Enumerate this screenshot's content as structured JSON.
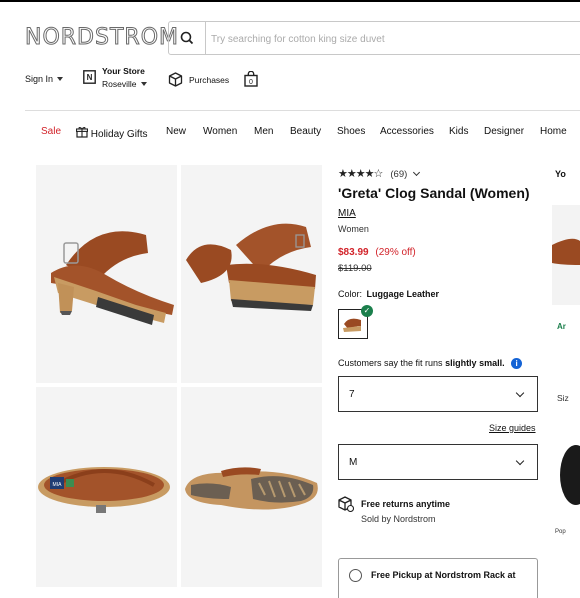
{
  "header": {
    "logo": "NORDSTROM",
    "search_placeholder": "Try searching for cotton king size duvet",
    "sign_in": "Sign In",
    "your_store": "Your Store",
    "store_name": "Roseville",
    "purchases": "Purchases"
  },
  "nav": [
    "Sale",
    "Holiday Gifts",
    "New",
    "Women",
    "Men",
    "Beauty",
    "Shoes",
    "Accessories",
    "Kids",
    "Designer",
    "Home"
  ],
  "product": {
    "rating_stars": "★★★★☆",
    "rating_count": "(69)",
    "title": "'Greta' Clog Sandal (Women)",
    "brand": "MIA",
    "department": "Women",
    "sale_price": "$83.99",
    "discount": "(29% off)",
    "original_price": "$119.00",
    "color_label": "Color:",
    "color_value": "Luggage Leather",
    "fit_note_prefix": "Customers say the fit runs",
    "fit_note_emphasis": "slightly small.",
    "size_value": "7",
    "size_guides": "Size guides",
    "width_value": "M",
    "returns_title": "Free returns anytime",
    "sold_by": "Sold by Nordstrom",
    "pickup_text": "Free Pickup at Nordstrom Rack at"
  },
  "side": {
    "heading": "Yo",
    "green_text": "Ar",
    "size_text": "Siz",
    "pop_text": "Pop"
  },
  "colors": {
    "sale_red": "#d2232a",
    "brown": "#9a4a22",
    "check_green": "#1b7f4c",
    "info_blue": "#1463d5"
  }
}
